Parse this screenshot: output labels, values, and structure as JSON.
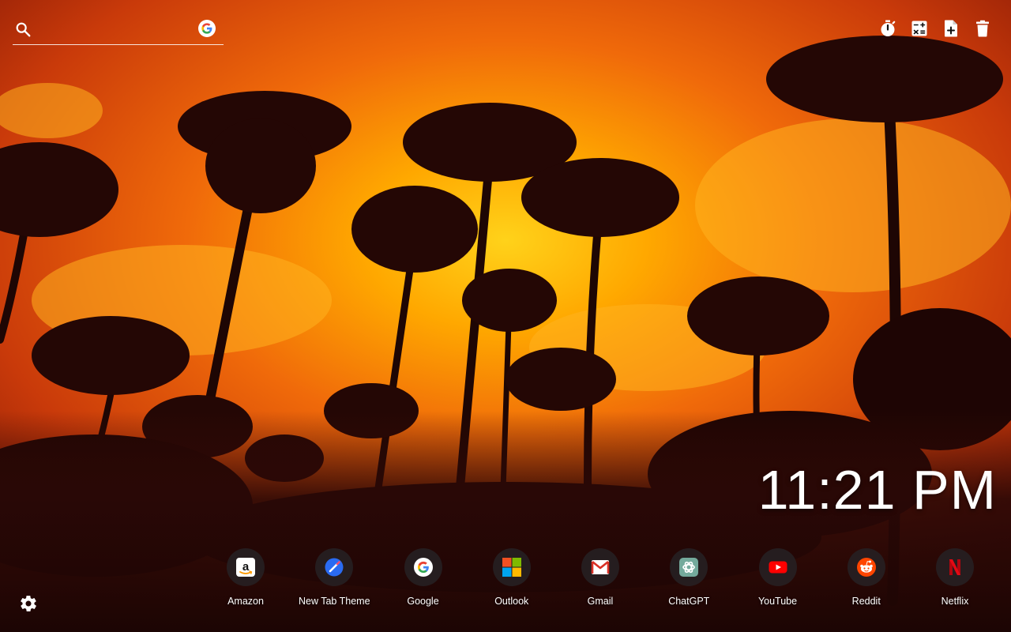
{
  "search": {
    "placeholder": "",
    "value": ""
  },
  "toolbar": {
    "icons": [
      "timer-icon",
      "calculator-icon",
      "new-note-icon",
      "trash-icon"
    ]
  },
  "clock": {
    "time": "11:21 PM"
  },
  "shortcuts": [
    {
      "label": "Amazon",
      "icon": "amazon-icon"
    },
    {
      "label": "New Tab Theme",
      "icon": "new-tab-theme-icon"
    },
    {
      "label": "Google",
      "icon": "google-icon"
    },
    {
      "label": "Outlook",
      "icon": "outlook-icon"
    },
    {
      "label": "Gmail",
      "icon": "gmail-icon"
    },
    {
      "label": "ChatGPT",
      "icon": "chatgpt-icon"
    },
    {
      "label": "YouTube",
      "icon": "youtube-icon"
    },
    {
      "label": "Reddit",
      "icon": "reddit-icon"
    },
    {
      "label": "Netflix",
      "icon": "netflix-icon"
    }
  ],
  "colors": {
    "sky_top": "#d9400a",
    "sky_glow": "#ffb400",
    "ground": "#2a0806",
    "shortcut_bg": "#262022"
  }
}
